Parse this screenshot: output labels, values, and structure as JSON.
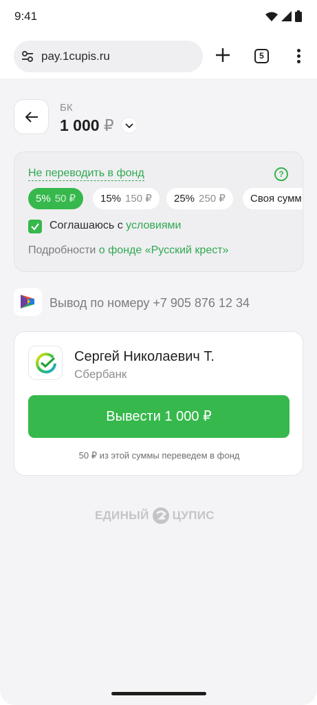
{
  "status_bar": {
    "time": "9:41"
  },
  "browser": {
    "url": "pay.1cupis.ru",
    "tab_count": "5"
  },
  "header": {
    "label": "БК",
    "amount": "1 000",
    "currency": "₽"
  },
  "fund": {
    "toggle_link": "Не переводить в фонд",
    "help": "?",
    "chips": [
      {
        "percent": "5%",
        "amount": "50 ₽",
        "selected": true
      },
      {
        "percent": "15%",
        "amount": "150 ₽",
        "selected": false
      },
      {
        "percent": "25%",
        "amount": "250 ₽",
        "selected": false
      },
      {
        "percent": "Своя сумм",
        "amount": "",
        "selected": false
      }
    ],
    "agree_prefix": "Соглашаюсь с ",
    "agree_link": "условиями",
    "agree_checked": true,
    "details_prefix": "Подробности ",
    "details_link": "о фонде «Русский крест»"
  },
  "withdraw_method": {
    "text": "Вывод по номеру +7 905 876 12 34"
  },
  "recipient": {
    "name": "Сергей Николаевич Т.",
    "bank": "Сбербанк",
    "button_label": "Вывести 1 000 ₽",
    "note": "50 ₽ из этой суммы переведем в фонд"
  },
  "footer": {
    "left_word": "ЕДИНЫЙ",
    "right_word": "ЦУПИС"
  },
  "colors": {
    "accent_green": "#36b84c",
    "link_green": "#2fa84f",
    "page_bg": "#f4f4f7"
  }
}
